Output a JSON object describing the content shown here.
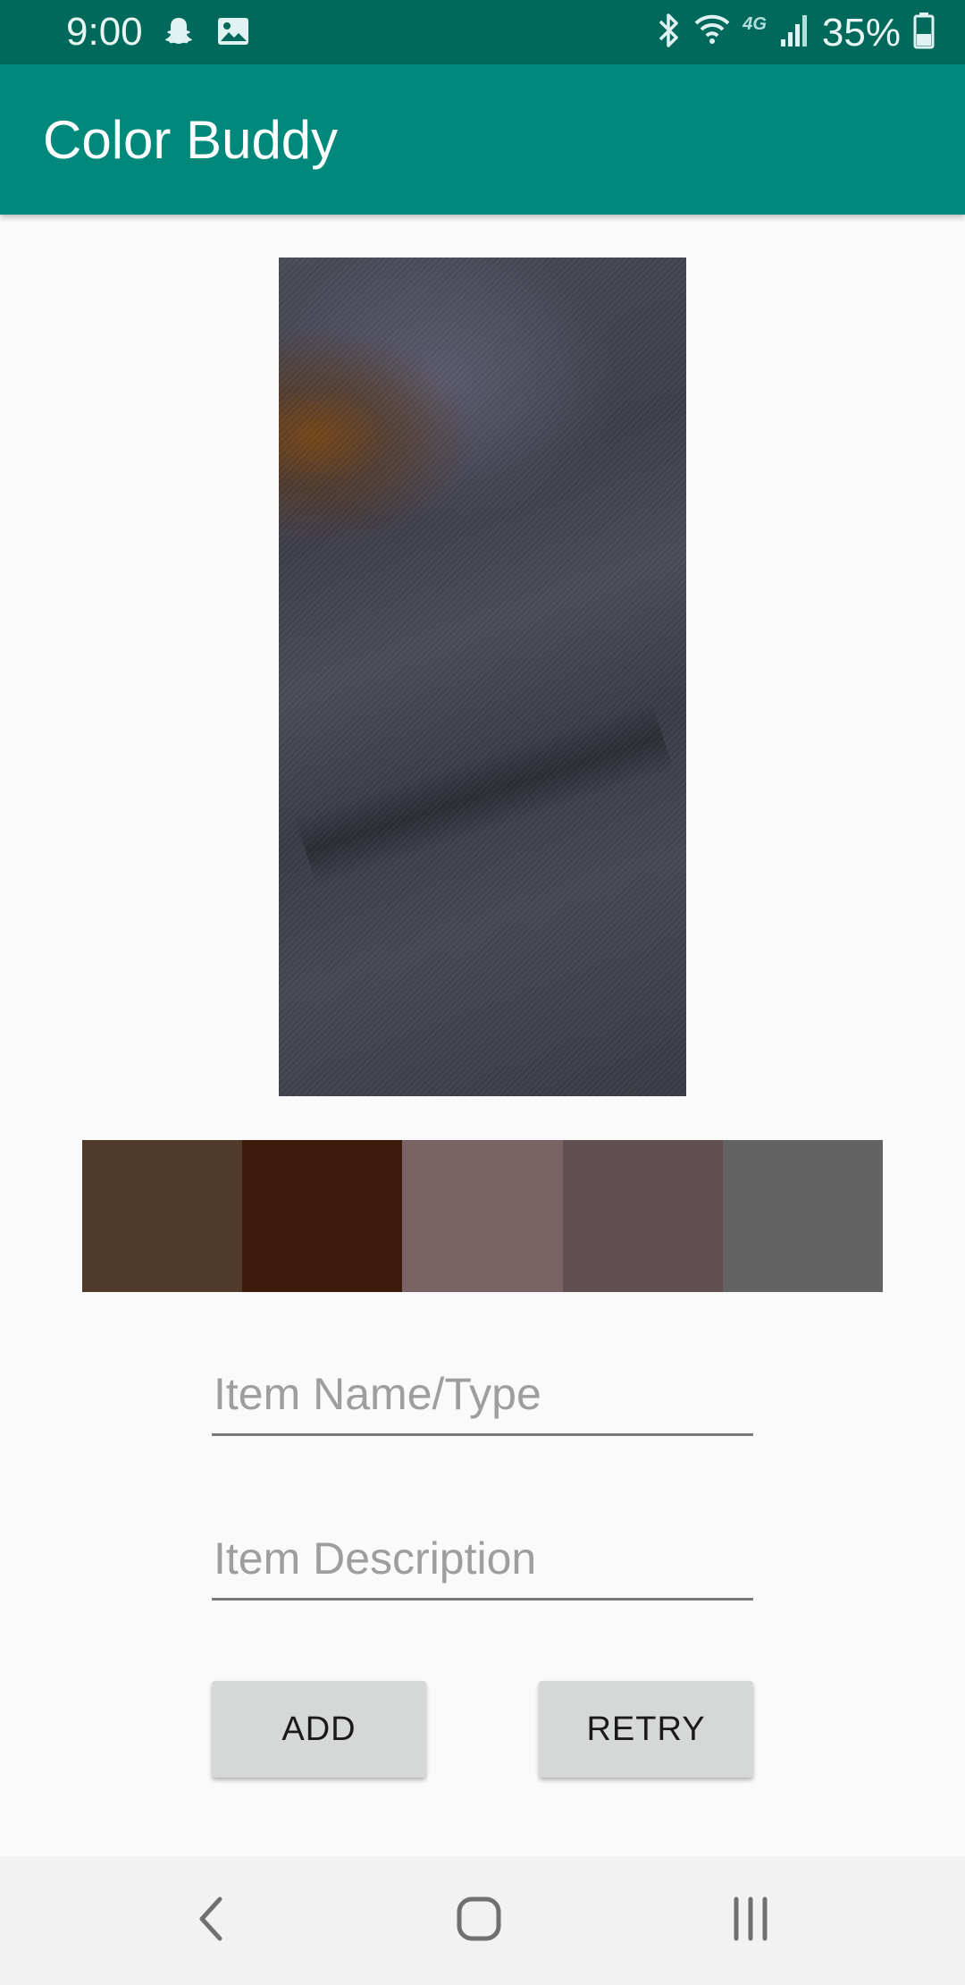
{
  "status_bar": {
    "time": "9:00",
    "battery_percent": "35%",
    "network": "4G",
    "icons": [
      "snapchat-icon",
      "gallery-icon",
      "bluetooth-icon",
      "wifi-icon",
      "signal-icon",
      "battery-icon"
    ]
  },
  "app_bar": {
    "title": "Color Buddy",
    "color": "#00897b",
    "status_color": "#00695c"
  },
  "photo": {
    "icon": "captured-fabric-photo"
  },
  "palette": {
    "swatches": [
      "#4f3a2b",
      "#3d1c0c",
      "#796364",
      "#634f51",
      "#636363"
    ]
  },
  "form": {
    "name_placeholder": "Item Name/Type",
    "name_value": "",
    "description_placeholder": "Item Description",
    "description_value": ""
  },
  "buttons": {
    "add_label": "ADD",
    "retry_label": "RETRY"
  },
  "nav_bar": {
    "icons": [
      "back-icon",
      "home-icon",
      "recents-icon"
    ]
  }
}
